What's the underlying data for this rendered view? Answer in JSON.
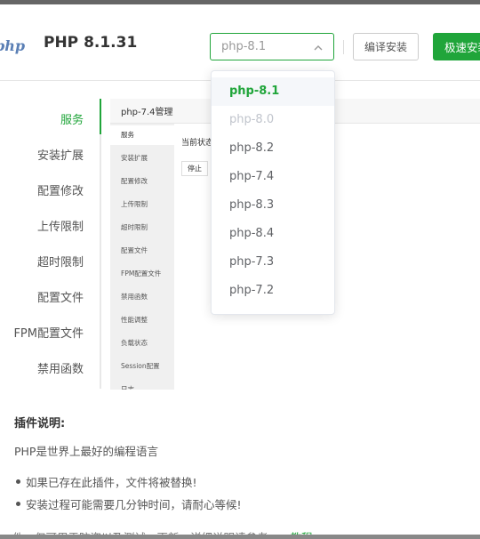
{
  "header": {
    "logo_text": "php",
    "title": "PHP 8.1.31",
    "version_select": {
      "value": "php-8.1"
    },
    "compile_button": "编译安装",
    "fast_install_button": "极速安装"
  },
  "version_options": [
    {
      "label": "php-8.1",
      "state": "selected"
    },
    {
      "label": "php-8.0",
      "state": "disabled"
    },
    {
      "label": "php-8.2",
      "state": "normal"
    },
    {
      "label": "php-7.4",
      "state": "normal"
    },
    {
      "label": "php-8.3",
      "state": "normal"
    },
    {
      "label": "php-8.4",
      "state": "normal"
    },
    {
      "label": "php-7.3",
      "state": "normal"
    },
    {
      "label": "php-7.2",
      "state": "normal"
    }
  ],
  "sidenav": {
    "items": [
      {
        "label": "服务",
        "active": true
      },
      {
        "label": "安装扩展"
      },
      {
        "label": "配置修改"
      },
      {
        "label": "上传限制"
      },
      {
        "label": "超时限制"
      },
      {
        "label": "配置文件"
      },
      {
        "label": "FPM配置文件"
      },
      {
        "label": "禁用函数"
      }
    ]
  },
  "preview": {
    "title": "php-7.4管理",
    "menu": [
      "服务",
      "安装扩展",
      "配置修改",
      "上传限制",
      "超时限制",
      "配置文件",
      "FPM配置文件",
      "禁用函数",
      "性能调整",
      "负载状态",
      "Session配置",
      "日志"
    ],
    "status_label": "当前状态",
    "stop_button": "停止"
  },
  "description": {
    "title": "插件说明:",
    "text": "PHP是世界上最好的编程语言",
    "bullets": [
      "如果已存在此插件，文件将被替换!",
      "安装过程可能需要几分钟时间，请耐心等候!"
    ],
    "cut_text": "件，仅可用于防盗以及测试，更新，详细说明请参考",
    "cut_link": ">>教程"
  },
  "colors": {
    "accent": "#20a53a",
    "logo": "#5a7fb5"
  },
  "icons": {
    "select_arrow": "chevron-up-icon"
  }
}
